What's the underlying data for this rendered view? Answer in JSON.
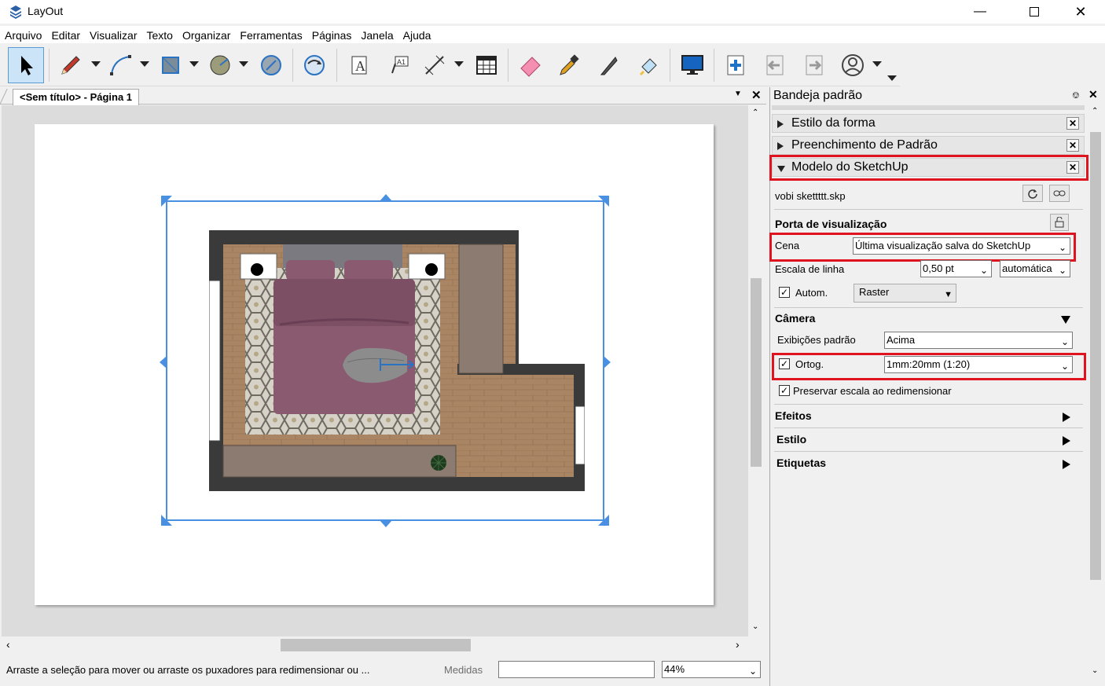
{
  "app": {
    "title": "LayOut"
  },
  "menu": [
    "Arquivo",
    "Editar",
    "Visualizar",
    "Texto",
    "Organizar",
    "Ferramentas",
    "Páginas",
    "Janela",
    "Ajuda"
  ],
  "toolbar": {
    "tools": [
      "select-tool",
      "line-tool",
      "arc-tool",
      "rectangle-tool",
      "circle-tool",
      "polygon-tool",
      "follow-me-tool",
      "text-tool",
      "label-tool",
      "dimension-tool",
      "table-tool",
      "eraser-tool",
      "sample-style-tool",
      "split-tool",
      "join-tool",
      "presentation-tool",
      "add-page-tool",
      "previous-page-tool",
      "next-page-tool",
      "account-tool"
    ]
  },
  "document": {
    "tab_label": "<Sem título> - Página 1"
  },
  "status": {
    "hint": "Arraste a seleção para mover ou arraste os puxadores para redimensionar ou ...",
    "measures_label": "Medidas",
    "measures_value": "",
    "zoom": "44%"
  },
  "panel": {
    "title": "Bandeja padrão",
    "sections": {
      "shape_style": "Estilo da forma",
      "pattern_fill": "Preenchimento de Padrão",
      "sketchup_model": "Modelo do SketchUp"
    },
    "file_name": "vobi skettttt.skp",
    "viewport_header": "Porta de visualização",
    "scene_label": "Cena",
    "scene_value": "Última visualização salva do SketchUp",
    "line_scale_label": "Escala de linha",
    "line_scale_value": "0,50 pt",
    "line_scale_mode": "automática",
    "auto_label": "Autom.",
    "auto_checked": true,
    "render_mode": "Raster",
    "camera_header": "Câmera",
    "standard_views_label": "Exibições padrão",
    "standard_views_value": "Acima",
    "ortho_label": "Ortog.",
    "ortho_checked": true,
    "ortho_scale": "1mm:20mm (1:20)",
    "preserve_scale_label": "Preservar escala ao redimensionar",
    "preserve_checked": true,
    "effects_header": "Efeitos",
    "style_header": "Estilo",
    "tags_header": "Etiquetas"
  },
  "colors": {
    "highlight_red": "#e0141e",
    "selection_blue": "#4a90e2",
    "bed_fabric": "#8a5a70",
    "wood_floor": "#a98563",
    "wall": "#3a3a3a"
  }
}
